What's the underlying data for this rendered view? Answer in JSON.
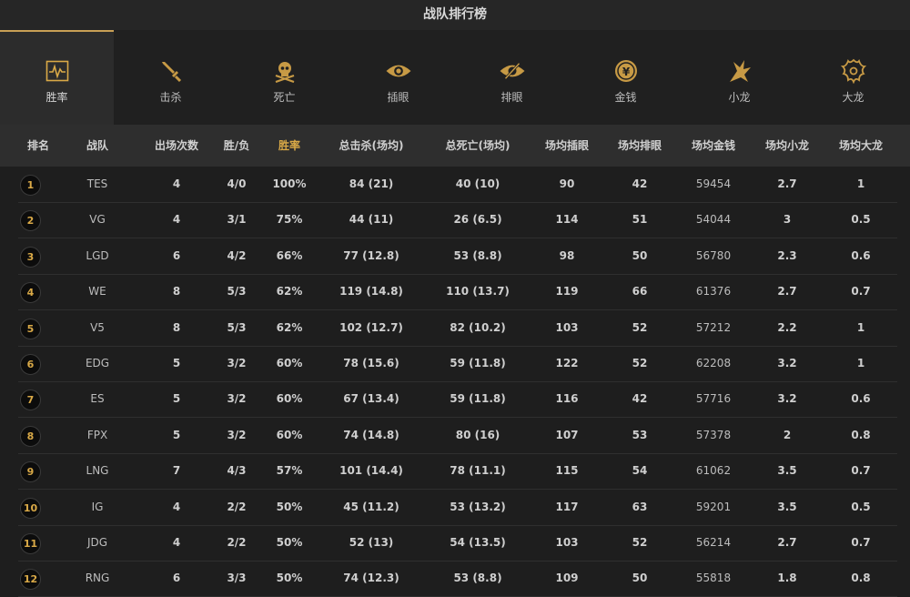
{
  "title": "战队排行榜",
  "tabs": [
    {
      "label": "胜率",
      "icon": "winrate-chart-icon",
      "active": true
    },
    {
      "label": "击杀",
      "icon": "sword-icon"
    },
    {
      "label": "死亡",
      "icon": "skull-icon"
    },
    {
      "label": "插眼",
      "icon": "eye-icon"
    },
    {
      "label": "排眼",
      "icon": "eye-slash-icon"
    },
    {
      "label": "金钱",
      "icon": "coin-icon"
    },
    {
      "label": "小龙",
      "icon": "dragon-icon"
    },
    {
      "label": "大龙",
      "icon": "baron-icon"
    }
  ],
  "columns": [
    "排名",
    "战队",
    "出场次数",
    "胜/负",
    "胜率",
    "总击杀(场均)",
    "总死亡(场均)",
    "场均插眼",
    "场均排眼",
    "场均金钱",
    "场均小龙",
    "场均大龙"
  ],
  "highlight_column": "胜率",
  "accent_color": "#d9a947",
  "rows": [
    {
      "rank": "1",
      "team": "TES",
      "games": "4",
      "wl": "4/0",
      "winrate": "100%",
      "kills": "84 (21)",
      "deaths": "40 (10)",
      "wards": "90",
      "wardsCleared": "42",
      "gold": "59454",
      "dragons": "2.7",
      "barons": "1"
    },
    {
      "rank": "2",
      "team": "VG",
      "games": "4",
      "wl": "3/1",
      "winrate": "75%",
      "kills": "44 (11)",
      "deaths": "26 (6.5)",
      "wards": "114",
      "wardsCleared": "51",
      "gold": "54044",
      "dragons": "3",
      "barons": "0.5"
    },
    {
      "rank": "3",
      "team": "LGD",
      "games": "6",
      "wl": "4/2",
      "winrate": "66%",
      "kills": "77 (12.8)",
      "deaths": "53 (8.8)",
      "wards": "98",
      "wardsCleared": "50",
      "gold": "56780",
      "dragons": "2.3",
      "barons": "0.6"
    },
    {
      "rank": "4",
      "team": "WE",
      "games": "8",
      "wl": "5/3",
      "winrate": "62%",
      "kills": "119 (14.8)",
      "deaths": "110 (13.7)",
      "wards": "119",
      "wardsCleared": "66",
      "gold": "61376",
      "dragons": "2.7",
      "barons": "0.7"
    },
    {
      "rank": "5",
      "team": "V5",
      "games": "8",
      "wl": "5/3",
      "winrate": "62%",
      "kills": "102 (12.7)",
      "deaths": "82 (10.2)",
      "wards": "103",
      "wardsCleared": "52",
      "gold": "57212",
      "dragons": "2.2",
      "barons": "1"
    },
    {
      "rank": "6",
      "team": "EDG",
      "games": "5",
      "wl": "3/2",
      "winrate": "60%",
      "kills": "78 (15.6)",
      "deaths": "59 (11.8)",
      "wards": "122",
      "wardsCleared": "52",
      "gold": "62208",
      "dragons": "3.2",
      "barons": "1"
    },
    {
      "rank": "7",
      "team": "ES",
      "games": "5",
      "wl": "3/2",
      "winrate": "60%",
      "kills": "67 (13.4)",
      "deaths": "59 (11.8)",
      "wards": "116",
      "wardsCleared": "42",
      "gold": "57716",
      "dragons": "3.2",
      "barons": "0.6"
    },
    {
      "rank": "8",
      "team": "FPX",
      "games": "5",
      "wl": "3/2",
      "winrate": "60%",
      "kills": "74 (14.8)",
      "deaths": "80 (16)",
      "wards": "107",
      "wardsCleared": "53",
      "gold": "57378",
      "dragons": "2",
      "barons": "0.8"
    },
    {
      "rank": "9",
      "team": "LNG",
      "games": "7",
      "wl": "4/3",
      "winrate": "57%",
      "kills": "101 (14.4)",
      "deaths": "78 (11.1)",
      "wards": "115",
      "wardsCleared": "54",
      "gold": "61062",
      "dragons": "3.5",
      "barons": "0.7"
    },
    {
      "rank": "10",
      "team": "IG",
      "games": "4",
      "wl": "2/2",
      "winrate": "50%",
      "kills": "45 (11.2)",
      "deaths": "53 (13.2)",
      "wards": "117",
      "wardsCleared": "63",
      "gold": "59201",
      "dragons": "3.5",
      "barons": "0.5"
    },
    {
      "rank": "11",
      "team": "JDG",
      "games": "4",
      "wl": "2/2",
      "winrate": "50%",
      "kills": "52 (13)",
      "deaths": "54 (13.5)",
      "wards": "103",
      "wardsCleared": "52",
      "gold": "56214",
      "dragons": "2.7",
      "barons": "0.7"
    },
    {
      "rank": "12",
      "team": "RNG",
      "games": "6",
      "wl": "3/3",
      "winrate": "50%",
      "kills": "74 (12.3)",
      "deaths": "53 (8.8)",
      "wards": "109",
      "wardsCleared": "50",
      "gold": "55818",
      "dragons": "1.8",
      "barons": "0.8"
    }
  ]
}
